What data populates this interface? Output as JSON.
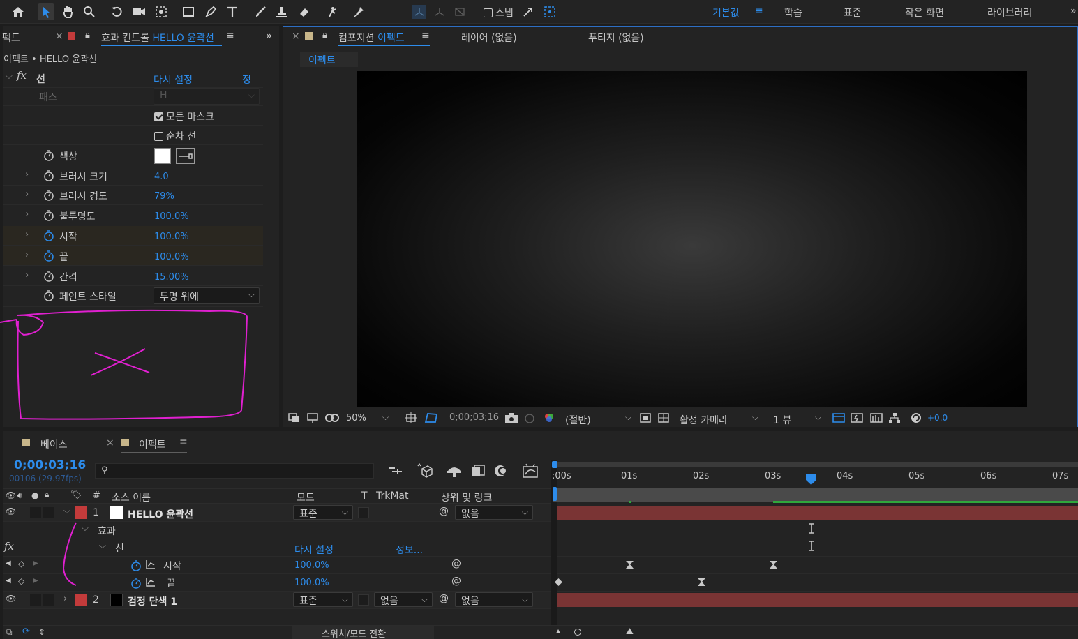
{
  "toolbar": {
    "snap_label": "스냅",
    "workspaces": [
      "기본값",
      "학습",
      "표준",
      "작은 화면",
      "라이브러리"
    ],
    "active_workspace": "기본값",
    "more_label": "»"
  },
  "effect_controls": {
    "left_tab_fragment": "펙트",
    "tab_prefix": "효과 컨트롤",
    "tab_layer": "HELLO 윤곽선",
    "breadcrumb": "이펙트 • HELLO 윤곽선",
    "effect_name": "선",
    "reset_label": "다시 설정",
    "about_label": "정보.",
    "path_label": "패스",
    "path_value": "H",
    "all_masks_label": "모든 마스크",
    "all_masks_checked": true,
    "sequential_label": "순차 선",
    "sequential_checked": false,
    "properties": [
      {
        "label": "색상",
        "value": ""
      },
      {
        "label": "브러시 크기",
        "value": "4.0"
      },
      {
        "label": "브러시 경도",
        "value": "79%"
      },
      {
        "label": "불투명도",
        "value": "100.0%"
      },
      {
        "label": "시작",
        "value": "100.0%"
      },
      {
        "label": "끝",
        "value": "100.0%"
      },
      {
        "label": "간격",
        "value": "15.00%"
      },
      {
        "label": "페인트 스타일",
        "value": "투명 위에"
      }
    ]
  },
  "composition": {
    "tab_prefix": "컴포지션",
    "tab_name": "이펙트",
    "layer_tab": "레이어 (없음)",
    "footage_tab": "푸티지 (없음)",
    "sub_tab": "이펙트",
    "zoom": "50%",
    "timecode": "0;00;03;16",
    "resolution": "(절반)",
    "camera": "활성 카메라",
    "views": "1 뷰",
    "exposure": "+0.0"
  },
  "timeline": {
    "tabs": [
      "베이스",
      "이펙트"
    ],
    "active_tab": "이펙트",
    "current_time": "0;00;03;16",
    "frame_info": "00106 (29.97fps)",
    "search_placeholder": "",
    "columns": {
      "num": "#",
      "source": "소스 이름",
      "mode": "모드",
      "t": "T",
      "trkmat": "TrkMat",
      "parent": "상위 및 링크"
    },
    "ruler": [
      ":00s",
      "01s",
      "02s",
      "03s",
      "04s",
      "05s",
      "06s",
      "07s"
    ],
    "layer1": {
      "num": "1",
      "name": "HELLO 윤곽선",
      "mode": "표준",
      "parent": "없음"
    },
    "effects_group": "효과",
    "effect_name": "선",
    "reset_label": "다시 설정",
    "about_label": "정보...",
    "prop_start": {
      "label": "시작",
      "value": "100.0%"
    },
    "prop_end": {
      "label": "끝",
      "value": "100.0%"
    },
    "layer2": {
      "num": "2",
      "name": "검정 단색 1",
      "mode": "표준",
      "trkmat": "없음",
      "parent": "없음"
    },
    "footer_toggle": "스위치/모드 전환"
  },
  "colors": {
    "accent": "#2d8ceb",
    "label_red": "#c33b3b",
    "annotation": "#e020d0"
  }
}
